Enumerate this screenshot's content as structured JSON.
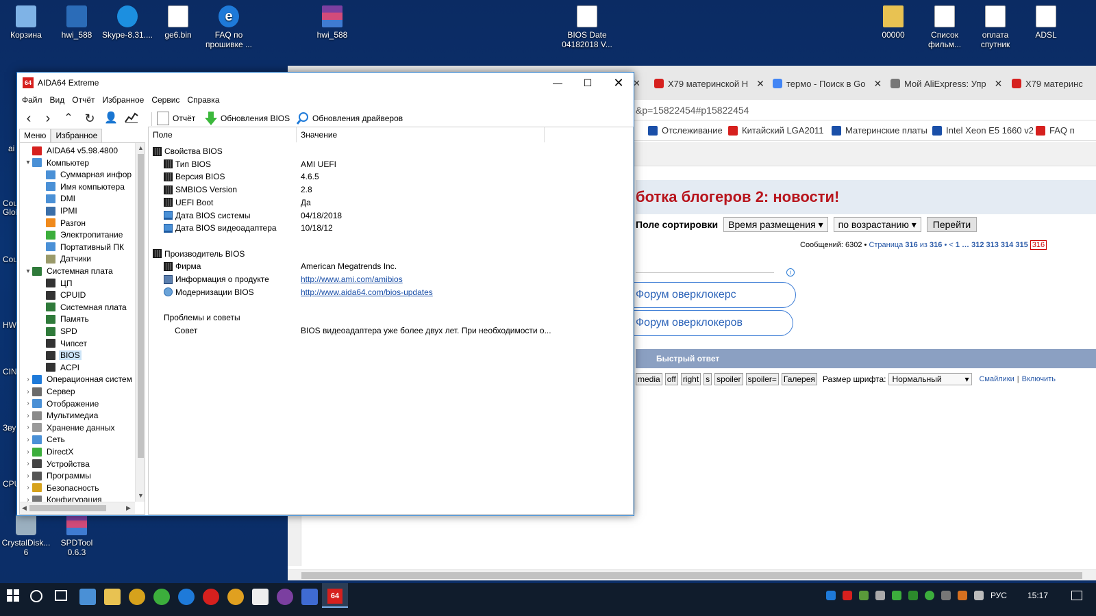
{
  "desktop": {
    "top_icons": [
      {
        "label": "Корзина",
        "icon": "recycle-bin-icon"
      },
      {
        "label": "hwi_588",
        "icon": "hwinfo-icon"
      },
      {
        "label": "Skype-8.31....",
        "icon": "skype-installer-icon"
      },
      {
        "label": "ge6.bin",
        "icon": "file-icon"
      },
      {
        "label": "FAQ по прошивке ...",
        "icon": "internet-shortcut-icon"
      },
      {
        "label": "hwi_588",
        "icon": "winrar-archive-icon"
      },
      {
        "label": "BIOS Date 04182018  V...",
        "icon": "file-icon"
      },
      {
        "label": "00000",
        "icon": "folder-icon"
      },
      {
        "label": "Список фильм...",
        "icon": "text-file-icon"
      },
      {
        "label": "оплата спутник",
        "icon": "text-file-icon"
      },
      {
        "label": "ADSL",
        "icon": "text-file-icon"
      }
    ],
    "bottom_icons": [
      {
        "label": "CrystalDisk... 6",
        "icon": "crystaldisk-icon"
      },
      {
        "label": "SPDTool 0.6.3",
        "icon": "winrar-archive-icon"
      }
    ],
    "side_labels": [
      "ai",
      "Cou",
      "Glob",
      "Cou",
      "HW",
      "CIN",
      "Звук",
      "CPU"
    ]
  },
  "browser": {
    "tabs": [
      {
        "label": "X79 материнской H",
        "color": "#d6201e"
      },
      {
        "label": "термо - Поиск в Go",
        "color": "#4285f4"
      },
      {
        "label": "Мой AliExpress: Упр",
        "color": "#777777"
      },
      {
        "label": "X79 материнс",
        "color": "#d6201e"
      }
    ],
    "address": "&p=15822454#p15822454",
    "bookmarks": [
      "Отслеживание",
      "Китайский LGA2011",
      "Материнские платы",
      "Intel Xeon E5 1660 v2",
      "FAQ п"
    ],
    "forum_title": "ботка блогеров 2: новости!",
    "sort": {
      "label": "Поле сортировки",
      "field": "Время размещения ▾",
      "order": "по возрастанию ▾",
      "go": "Перейти"
    },
    "pagination": {
      "prefix": "Сообщений: 6302 • ",
      "page_text": "Страница",
      "page": "316",
      "of": "из",
      "total": "316",
      "nav": "• <",
      "pages": "1 … 312  313  314  315",
      "current": "316"
    },
    "forum_links": [
      "Форум оверклокерс",
      "Форум оверклокеров"
    ],
    "quick_reply": "Быстрый ответ",
    "bbcodes": [
      "media",
      "off",
      "right",
      "s",
      "spoiler",
      "spoiler=",
      "Галерея"
    ],
    "font_size_label": "Размер шрифта:",
    "font_size_value": "Нормальный",
    "smilies": "Смайлики",
    "separator": "|",
    "enable": "Включить"
  },
  "aida": {
    "title": "AIDA64 Extreme",
    "logo": "64",
    "menu": [
      "Файл",
      "Вид",
      "Отчёт",
      "Избранное",
      "Сервис",
      "Справка"
    ],
    "toolbar": {
      "report": "Отчёт",
      "bios_updates": "Обновления BIOS",
      "driver_updates": "Обновления драйверов"
    },
    "left_tabs": [
      "Меню",
      "Избранное"
    ],
    "tree": [
      {
        "label": "AIDA64 v5.98.4800",
        "level": 0,
        "exp": "",
        "icon": "#d6201e"
      },
      {
        "label": "Компьютер",
        "level": 0,
        "exp": "⌄",
        "icon": "#4a90d6"
      },
      {
        "label": "Суммарная инфор",
        "level": 1,
        "exp": "",
        "icon": "#4a90d6"
      },
      {
        "label": "Имя компьютера",
        "level": 1,
        "exp": "",
        "icon": "#4a90d6"
      },
      {
        "label": "DMI",
        "level": 1,
        "exp": "",
        "icon": "#4a90d6"
      },
      {
        "label": "IPMI",
        "level": 1,
        "exp": "",
        "icon": "#3a6ea8"
      },
      {
        "label": "Разгон",
        "level": 1,
        "exp": "",
        "icon": "#f08a1c"
      },
      {
        "label": "Электропитание",
        "level": 1,
        "exp": "",
        "icon": "#3cae3c"
      },
      {
        "label": "Портативный ПК",
        "level": 1,
        "exp": "",
        "icon": "#4a90d6"
      },
      {
        "label": "Датчики",
        "level": 1,
        "exp": "",
        "icon": "#9a9a6a"
      },
      {
        "label": "Системная плата",
        "level": 0,
        "exp": "⌄",
        "icon": "#2f7a3a"
      },
      {
        "label": "ЦП",
        "level": 1,
        "exp": "",
        "icon": "#333333"
      },
      {
        "label": "CPUID",
        "level": 1,
        "exp": "",
        "icon": "#333333"
      },
      {
        "label": "Системная плата",
        "level": 1,
        "exp": "",
        "icon": "#2f7a3a"
      },
      {
        "label": "Память",
        "level": 1,
        "exp": "",
        "icon": "#2f7a3a"
      },
      {
        "label": "SPD",
        "level": 1,
        "exp": "",
        "icon": "#2f7a3a"
      },
      {
        "label": "Чипсет",
        "level": 1,
        "exp": "",
        "icon": "#333333"
      },
      {
        "label": "BIOS",
        "level": 1,
        "exp": "",
        "icon": "#333333",
        "selected": true
      },
      {
        "label": "ACPI",
        "level": 1,
        "exp": "",
        "icon": "#333333"
      },
      {
        "label": "Операционная систем",
        "level": 0,
        "exp": "›",
        "icon": "#1e7ad9"
      },
      {
        "label": "Сервер",
        "level": 0,
        "exp": "›",
        "icon": "#6b6b6b"
      },
      {
        "label": "Отображение",
        "level": 0,
        "exp": "›",
        "icon": "#4a90d6"
      },
      {
        "label": "Мультимедиа",
        "level": 0,
        "exp": "›",
        "icon": "#8a8a8a"
      },
      {
        "label": "Хранение данных",
        "level": 0,
        "exp": "›",
        "icon": "#9a9a9a"
      },
      {
        "label": "Сеть",
        "level": 0,
        "exp": "›",
        "icon": "#4a90d6"
      },
      {
        "label": "DirectX",
        "level": 0,
        "exp": "›",
        "icon": "#3cae3c"
      },
      {
        "label": "Устройства",
        "level": 0,
        "exp": "›",
        "icon": "#444444"
      },
      {
        "label": "Программы",
        "level": 0,
        "exp": "›",
        "icon": "#555555"
      },
      {
        "label": "Безопасность",
        "level": 0,
        "exp": "›",
        "icon": "#d6a21c"
      },
      {
        "label": "Конфигурация",
        "level": 0,
        "exp": "›",
        "icon": "#777777"
      }
    ],
    "columns": [
      "Поле",
      "Значение"
    ],
    "rows": [
      {
        "field": "Свойства BIOS",
        "value": "",
        "indent": 0,
        "icon": "chip",
        "link": false
      },
      {
        "field": "Тип BIOS",
        "value": "AMI UEFI",
        "indent": 1,
        "icon": "chip",
        "link": false
      },
      {
        "field": "Версия BIOS",
        "value": "4.6.5",
        "indent": 1,
        "icon": "chip",
        "link": false
      },
      {
        "field": "SMBIOS Version",
        "value": "2.8",
        "indent": 1,
        "icon": "chip",
        "link": false
      },
      {
        "field": "UEFI Boot",
        "value": "Да",
        "indent": 1,
        "icon": "chip",
        "link": false
      },
      {
        "field": "Дата BIOS системы",
        "value": "04/18/2018",
        "indent": 1,
        "icon": "mon",
        "link": false
      },
      {
        "field": "Дата BIOS видеоадаптера",
        "value": "10/18/12",
        "indent": 1,
        "icon": "mon",
        "link": false
      },
      {
        "field": "",
        "value": "",
        "indent": 0,
        "icon": "",
        "link": false
      },
      {
        "field": "Производитель BIOS",
        "value": "",
        "indent": 0,
        "icon": "chip",
        "link": false
      },
      {
        "field": "Фирма",
        "value": "American Megatrends Inc.",
        "indent": 1,
        "icon": "chip",
        "link": false
      },
      {
        "field": "Информация о продукте",
        "value": "http://www.ami.com/amibios",
        "indent": 1,
        "icon": "info",
        "link": true
      },
      {
        "field": "Модернизации BIOS",
        "value": "http://www.aida64.com/bios-updates",
        "indent": 1,
        "icon": "globe",
        "link": true
      },
      {
        "field": "",
        "value": "",
        "indent": 0,
        "icon": "",
        "link": false
      },
      {
        "field": "Проблемы и советы",
        "value": "",
        "indent": 1,
        "icon": "",
        "link": false
      },
      {
        "field": "Совет",
        "value": "BIOS видеоадаптера уже более двух лет. При необходимости о...",
        "indent": 2,
        "icon": "",
        "link": false
      }
    ]
  },
  "taskbar": {
    "language": "РУС",
    "time": "15:17",
    "active_app": "64"
  }
}
